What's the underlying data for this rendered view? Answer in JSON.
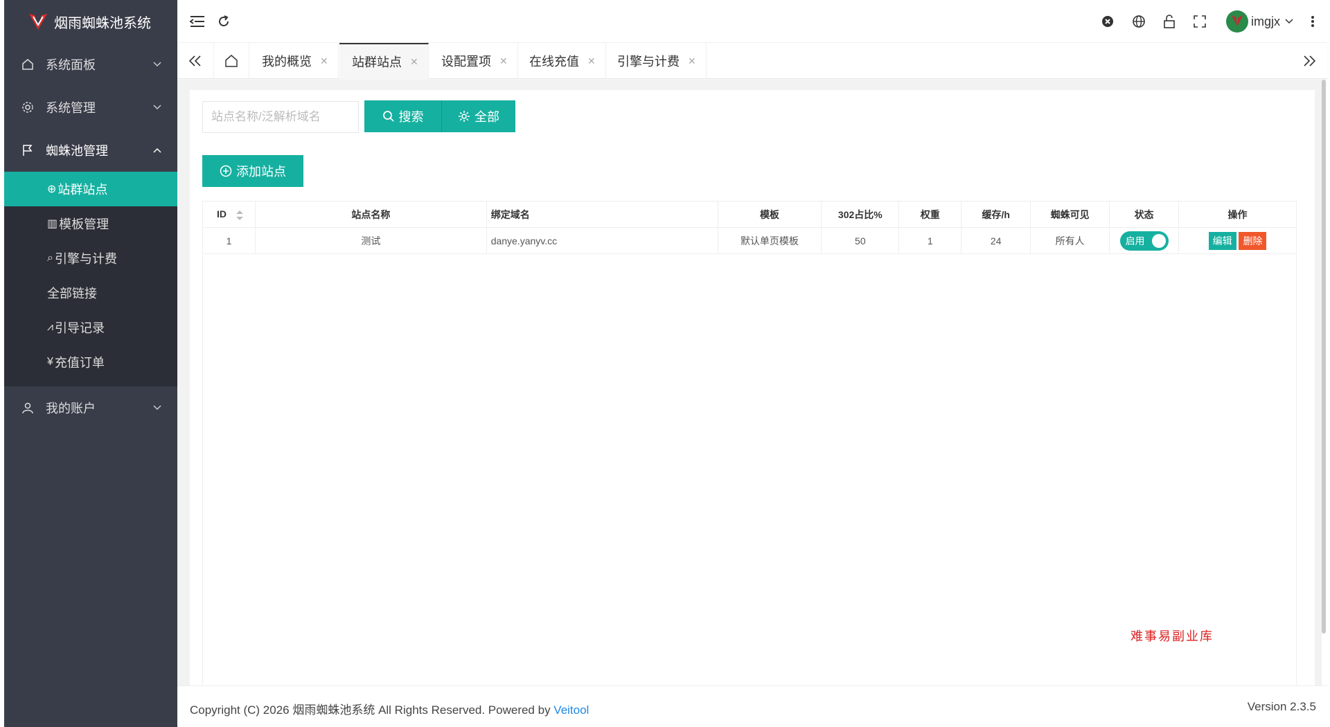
{
  "app": {
    "title": "烟雨蜘蛛池系统"
  },
  "sidebar": {
    "items": [
      {
        "label": "系统面板",
        "icon": "home-icon"
      },
      {
        "label": "系统管理",
        "icon": "gear-icon"
      },
      {
        "label": "蜘蛛池管理",
        "icon": "flag-icon"
      },
      {
        "label": "我的账户",
        "icon": "user-icon"
      }
    ],
    "sub": [
      {
        "icon": "⊕",
        "label": "站群站点"
      },
      {
        "icon": "▥",
        "label": "模板管理"
      },
      {
        "icon": "⌕",
        "label": "引擎与计费"
      },
      {
        "icon": "",
        "label": "全部链接"
      },
      {
        "icon": "⩘",
        "label": "引导记录"
      },
      {
        "icon": "¥",
        "label": "充值订单"
      }
    ]
  },
  "header": {
    "username": "imgjx"
  },
  "tabs": [
    {
      "label": "我的概览"
    },
    {
      "label": "站群站点"
    },
    {
      "label": "设配置项"
    },
    {
      "label": "在线充值"
    },
    {
      "label": "引擎与计费"
    }
  ],
  "toolbar": {
    "search_placeholder": "站点名称/泛解析域名",
    "search_label": "搜索",
    "all_label": "全部",
    "add_label": "添加站点"
  },
  "table": {
    "columns": [
      "ID",
      "站点名称",
      "绑定域名",
      "模板",
      "302占比%",
      "权重",
      "缓存/h",
      "蜘蛛可见",
      "状态",
      "操作"
    ],
    "rows": [
      {
        "id": "1",
        "name": "测试",
        "domain": "danye.yanyv.cc",
        "template": "默认单页模板",
        "ratio": "50",
        "weight": "1",
        "cache": "24",
        "visible": "所有人",
        "status": "启用",
        "edit": "编辑",
        "delete": "删除"
      }
    ]
  },
  "watermark": "难事易副业库",
  "footer": {
    "copyright": "Copyright (C) 2026 烟雨蜘蛛池系统 All Rights Reserved. Powered by ",
    "powered_by": "Veitool",
    "version": "Version 2.3.5"
  },
  "colors": {
    "accent": "#16b0a0",
    "danger": "#f0582c",
    "sidebar": "#393d49",
    "sidebar_sub": "#2b2e36"
  }
}
